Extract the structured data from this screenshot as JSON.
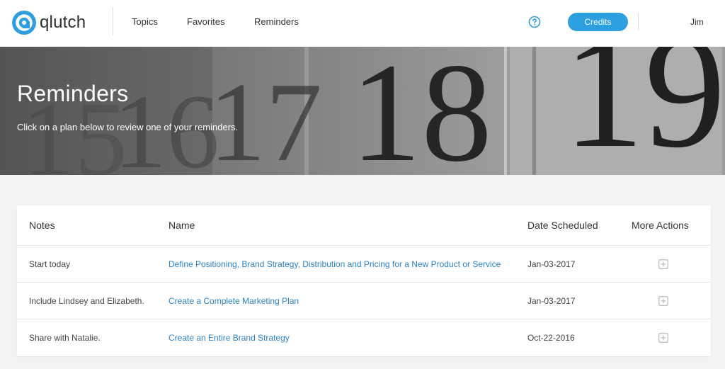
{
  "header": {
    "logo_text": "qlutch",
    "nav": {
      "topics": "Topics",
      "favorites": "Favorites",
      "reminders": "Reminders"
    },
    "help_icon": "question-circle-icon",
    "credits_label": "Credits",
    "user_name": "Jim"
  },
  "hero": {
    "title": "Reminders",
    "subtitle": "Click on a plan below to review one of your reminders."
  },
  "table": {
    "headers": {
      "notes": "Notes",
      "name": "Name",
      "date": "Date Scheduled",
      "actions": "More Actions"
    },
    "rows": [
      {
        "notes": "Start today",
        "name": "Define Positioning, Brand Strategy, Distribution and Pricing for a New Product or Service",
        "date": "Jan-03-2017",
        "action_icon": "plus-square-icon"
      },
      {
        "notes": "Include Lindsey and Elizabeth.",
        "name": "Create a Complete Marketing Plan",
        "date": "Jan-03-2017",
        "action_icon": "plus-square-icon"
      },
      {
        "notes": "Share with Natalie.",
        "name": "Create an Entire Brand Strategy",
        "date": "Oct-22-2016",
        "action_icon": "plus-square-icon"
      }
    ]
  },
  "colors": {
    "accent": "#2d9ee0",
    "link": "#2b84c4",
    "page_background": "#f0f2f4"
  }
}
